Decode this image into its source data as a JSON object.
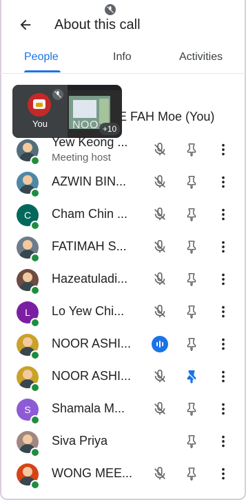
{
  "header": {
    "title": "About this call",
    "back_icon": "arrow-back-icon"
  },
  "tabs": [
    {
      "label": "People",
      "active": true
    },
    {
      "label": "Info",
      "active": false
    },
    {
      "label": "Activities",
      "active": false
    }
  ],
  "self": {
    "name_visible": "E FAH Moe (You)"
  },
  "pip": {
    "you_label": "You",
    "grid_text": "NOO",
    "more_count": "+10"
  },
  "participants": [
    {
      "name": "Yew Keong ...",
      "sub": "Meeting host",
      "avatar": "photo",
      "mic": "muted",
      "pinned": false,
      "avatar_color": "#546e7a"
    },
    {
      "name": "AZWIN BIN...",
      "avatar": "photo",
      "mic": "muted",
      "pinned": false,
      "avatar_color": "#4e88a6"
    },
    {
      "name": "Cham Chin ...",
      "avatar": "letter",
      "letter": "C",
      "mic": "muted",
      "pinned": false,
      "avatar_color": "#00695c"
    },
    {
      "name": "FATIMAH S...",
      "avatar": "photo",
      "mic": "muted",
      "pinned": false,
      "avatar_color": "#6d7c8a"
    },
    {
      "name": "Hazeatuladi...",
      "avatar": "photo",
      "mic": "muted",
      "pinned": false,
      "avatar_color": "#6d4c41"
    },
    {
      "name": "Lo Yew Chi...",
      "avatar": "letter",
      "letter": "L",
      "mic": "muted",
      "pinned": false,
      "avatar_color": "#7b1fa2"
    },
    {
      "name": "NOOR ASHI...",
      "avatar": "photo",
      "mic": "speaking",
      "pinned": false,
      "avatar_color": "#c9a227"
    },
    {
      "name": "NOOR ASHI...",
      "avatar": "photo",
      "mic": "muted",
      "pinned": true,
      "avatar_color": "#c9a227"
    },
    {
      "name": "Shamala M...",
      "avatar": "letter",
      "letter": "S",
      "mic": "muted",
      "pinned": false,
      "avatar_color": "#8e5bd6"
    },
    {
      "name": "Siva Priya",
      "avatar": "photo",
      "mic": "none",
      "pinned": false,
      "avatar_color": "#a1887f"
    },
    {
      "name": "WONG MEE...",
      "avatar": "photo",
      "mic": "muted",
      "pinned": false,
      "avatar_color": "#d84315"
    }
  ],
  "colors": {
    "accent": "#1a73e8",
    "online": "#1e8e3e",
    "pinned": "#1a73e8"
  }
}
